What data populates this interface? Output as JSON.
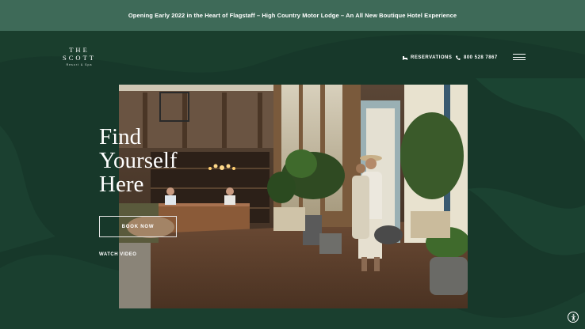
{
  "announcement": "Opening Early 2022 in the Heart of Flagstaff – High Country Motor Lodge – An All New Boutique Hotel Experience",
  "logo": {
    "line1": "THE",
    "line2": "SCOTT",
    "sub": "Resort & Spa"
  },
  "nav": {
    "reservations": "RESERVATIONS",
    "phone": "800 528 7867"
  },
  "hero": {
    "headline": [
      "Find",
      "Yourself",
      "Here"
    ],
    "book_now": "BOOK NOW",
    "watch_video": "WATCH VIDEO"
  },
  "icons": {
    "reservations": "bed-icon",
    "phone": "phone-icon",
    "menu": "hamburger-menu-icon",
    "accessibility": "accessibility-icon"
  },
  "colors": {
    "background": "#17382a",
    "announcement_bar": "#3e6a58",
    "text": "#ffffff"
  }
}
